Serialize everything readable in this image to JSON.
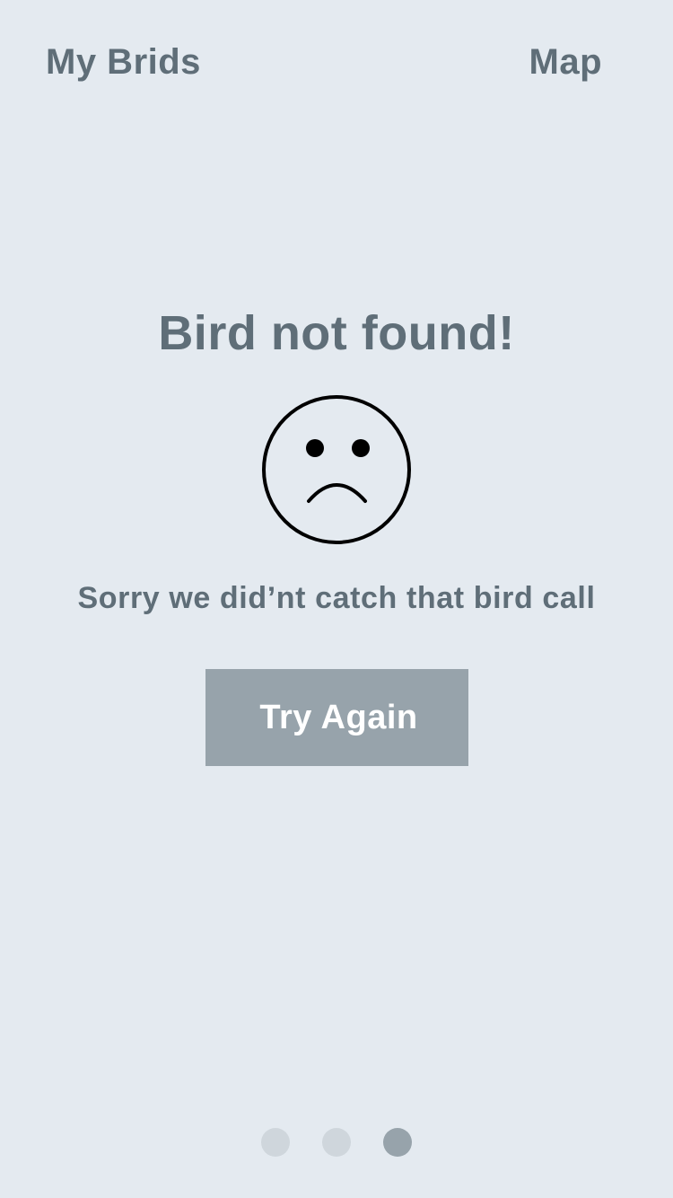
{
  "nav": {
    "left_label": "My Brids",
    "right_label": "Map"
  },
  "main": {
    "title": "Bird not found!",
    "icon": "sad-face-icon",
    "message": "Sorry we did’nt catch that bird call",
    "button_label": "Try Again"
  },
  "pager": {
    "total_pages": 3,
    "active_page": 3
  },
  "colors": {
    "background": "#E4EAF0",
    "text": "#5F6E78",
    "button": "#97A3AB",
    "button_text": "#FFFFFF",
    "dot_inactive": "#CFD6DC",
    "dot_active": "#97A3AB"
  }
}
